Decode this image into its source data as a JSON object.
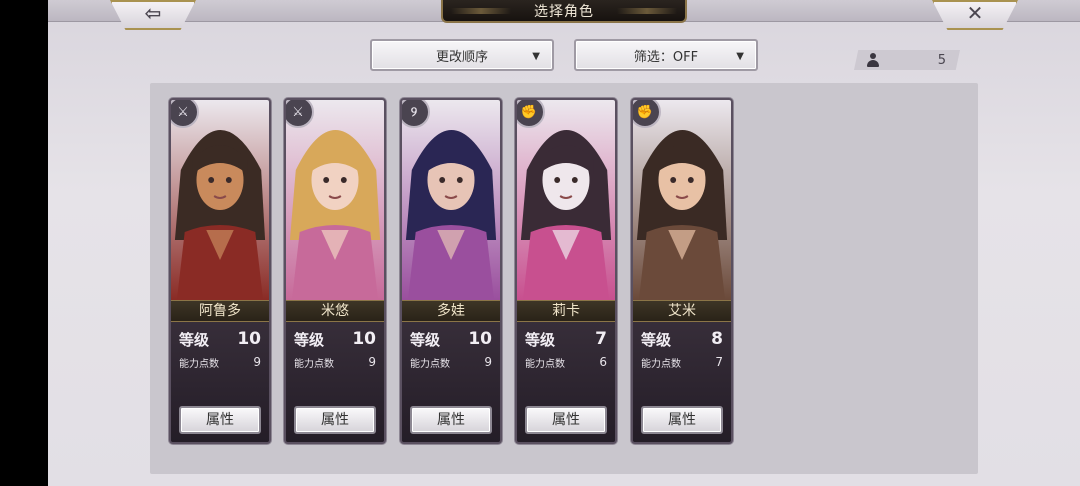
{
  "header": {
    "title": "选择角色",
    "back_icon": "arrow-left-icon",
    "close_icon": "close-icon"
  },
  "controls": {
    "order_label": "更改顺序",
    "filter_label": "筛选：OFF",
    "party_count": "5"
  },
  "labels": {
    "level": "等级",
    "points": "能力点数",
    "attribute_button": "属性"
  },
  "characters": [
    {
      "name": "阿鲁多",
      "level": "10",
      "points": "9",
      "class_icon": "sword-icon",
      "portrait_colors": [
        "#3b2b24",
        "#8a2b25",
        "#c98a5c"
      ]
    },
    {
      "name": "米悠",
      "level": "10",
      "points": "9",
      "class_icon": "sword-icon",
      "portrait_colors": [
        "#d8a85a",
        "#c76a9a",
        "#f1d2c2"
      ]
    },
    {
      "name": "多娃",
      "level": "10",
      "points": "9",
      "class_icon": "staff-icon",
      "portrait_colors": [
        "#2a2654",
        "#9a4f9e",
        "#e7c4b6"
      ]
    },
    {
      "name": "莉卡",
      "level": "7",
      "points": "6",
      "class_icon": "fist-icon",
      "portrait_colors": [
        "#3a2b36",
        "#c8508f",
        "#efe7ec"
      ]
    },
    {
      "name": "艾米",
      "level": "8",
      "points": "7",
      "class_icon": "fist-icon",
      "portrait_colors": [
        "#3a2a24",
        "#6b4a3a",
        "#e8c1a5"
      ]
    }
  ]
}
